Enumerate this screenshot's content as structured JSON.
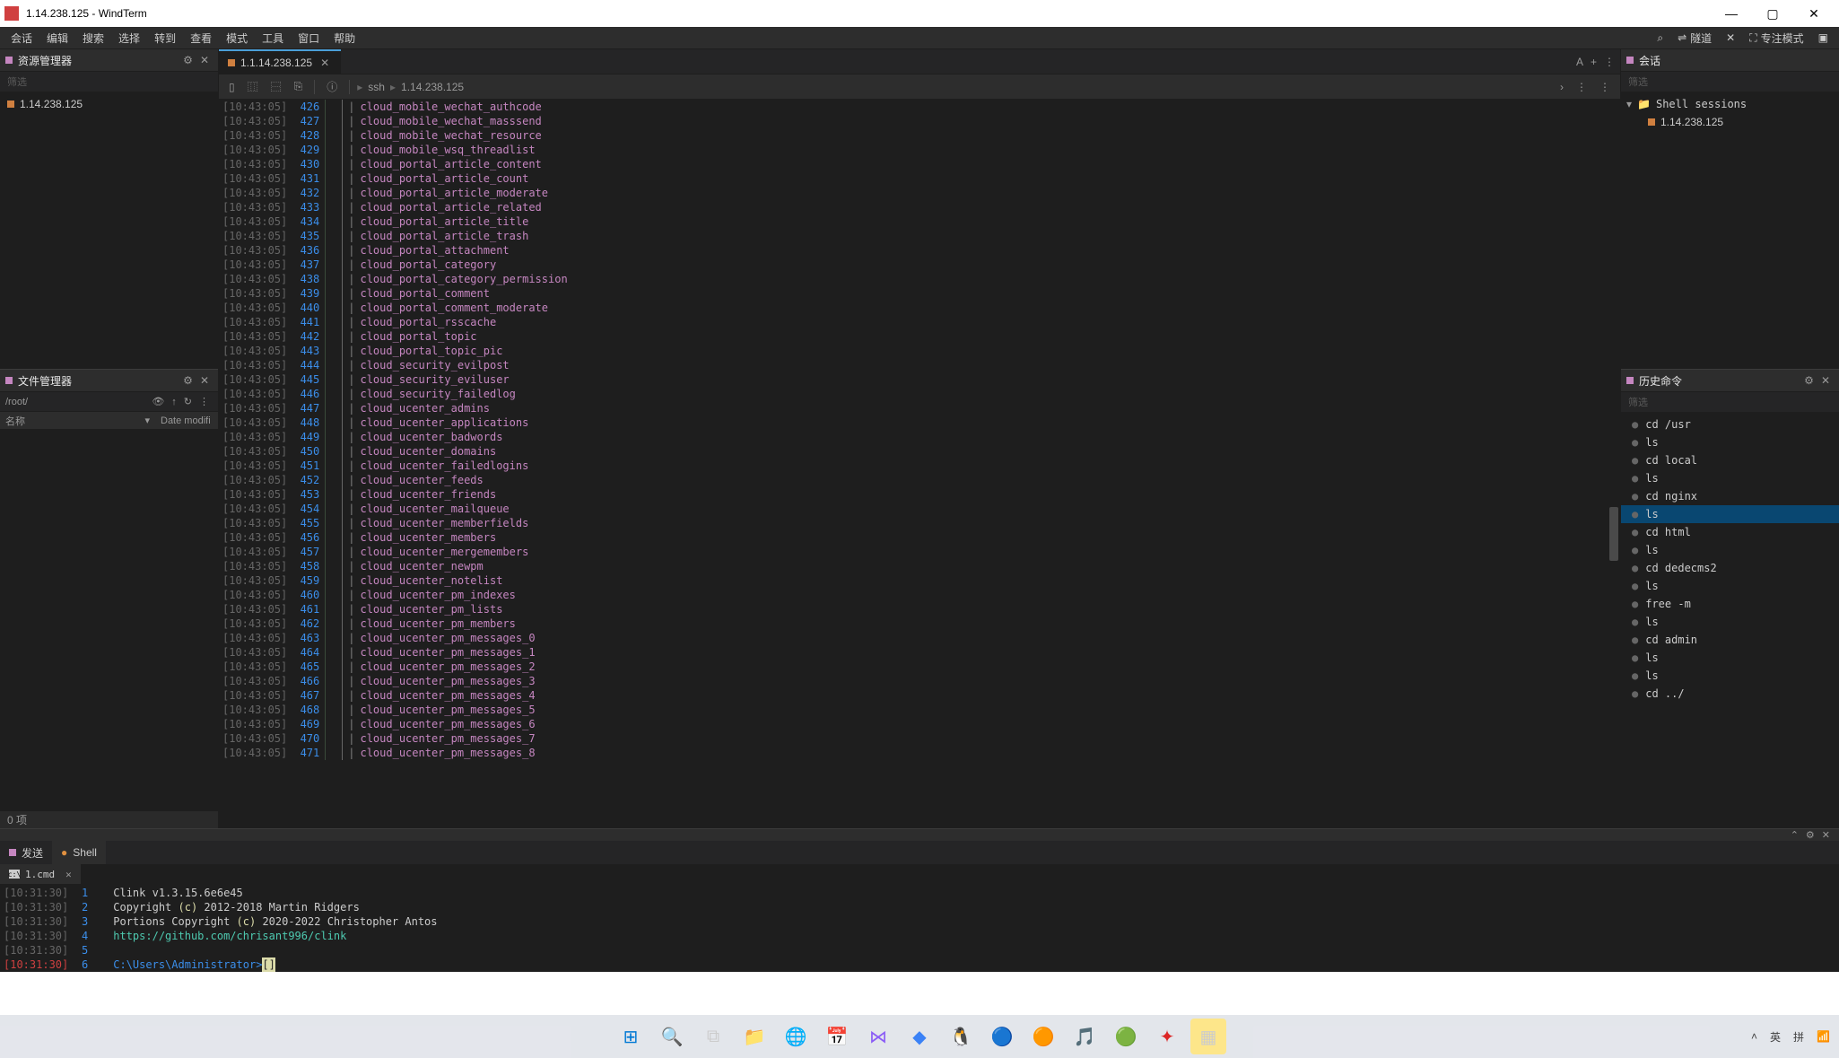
{
  "window": {
    "title": "1.14.238.125 - WindTerm"
  },
  "menu": {
    "items": [
      "会话",
      "编辑",
      "搜索",
      "选择",
      "转到",
      "查看",
      "模式",
      "工具",
      "窗口",
      "帮助"
    ],
    "right": {
      "search": "⌕",
      "tunnel": "隧道",
      "focus_mode": "专注模式"
    }
  },
  "explorer": {
    "title": "资源管理器",
    "filter": "筛选",
    "items": [
      {
        "label": "1.14.238.125"
      }
    ]
  },
  "files": {
    "title": "文件管理器",
    "path": "/root/",
    "col_name": "名称",
    "col_date": "Date modifi",
    "footer": "0 项"
  },
  "tabs": {
    "items": [
      {
        "label": "1.1.14.238.125",
        "active": true
      }
    ],
    "right_icons": [
      "A",
      "+",
      "⋮"
    ]
  },
  "toolbar": {
    "breadcrumb": [
      "ssh",
      "1.14.238.125"
    ]
  },
  "terminal_rows": [
    {
      "ts": "[10:43:05]",
      "ln": "426",
      "txt": "cloud_mobile_wechat_authcode"
    },
    {
      "ts": "[10:43:05]",
      "ln": "427",
      "txt": "cloud_mobile_wechat_masssend"
    },
    {
      "ts": "[10:43:05]",
      "ln": "428",
      "txt": "cloud_mobile_wechat_resource"
    },
    {
      "ts": "[10:43:05]",
      "ln": "429",
      "txt": "cloud_mobile_wsq_threadlist"
    },
    {
      "ts": "[10:43:05]",
      "ln": "430",
      "txt": "cloud_portal_article_content"
    },
    {
      "ts": "[10:43:05]",
      "ln": "431",
      "txt": "cloud_portal_article_count"
    },
    {
      "ts": "[10:43:05]",
      "ln": "432",
      "txt": "cloud_portal_article_moderate"
    },
    {
      "ts": "[10:43:05]",
      "ln": "433",
      "txt": "cloud_portal_article_related"
    },
    {
      "ts": "[10:43:05]",
      "ln": "434",
      "txt": "cloud_portal_article_title"
    },
    {
      "ts": "[10:43:05]",
      "ln": "435",
      "txt": "cloud_portal_article_trash"
    },
    {
      "ts": "[10:43:05]",
      "ln": "436",
      "txt": "cloud_portal_attachment"
    },
    {
      "ts": "[10:43:05]",
      "ln": "437",
      "txt": "cloud_portal_category"
    },
    {
      "ts": "[10:43:05]",
      "ln": "438",
      "txt": "cloud_portal_category_permission"
    },
    {
      "ts": "[10:43:05]",
      "ln": "439",
      "txt": "cloud_portal_comment"
    },
    {
      "ts": "[10:43:05]",
      "ln": "440",
      "txt": "cloud_portal_comment_moderate"
    },
    {
      "ts": "[10:43:05]",
      "ln": "441",
      "txt": "cloud_portal_rsscache"
    },
    {
      "ts": "[10:43:05]",
      "ln": "442",
      "txt": "cloud_portal_topic"
    },
    {
      "ts": "[10:43:05]",
      "ln": "443",
      "txt": "cloud_portal_topic_pic"
    },
    {
      "ts": "[10:43:05]",
      "ln": "444",
      "txt": "cloud_security_evilpost"
    },
    {
      "ts": "[10:43:05]",
      "ln": "445",
      "txt": "cloud_security_eviluser"
    },
    {
      "ts": "[10:43:05]",
      "ln": "446",
      "txt": "cloud_security_failedlog"
    },
    {
      "ts": "[10:43:05]",
      "ln": "447",
      "txt": "cloud_ucenter_admins"
    },
    {
      "ts": "[10:43:05]",
      "ln": "448",
      "txt": "cloud_ucenter_applications"
    },
    {
      "ts": "[10:43:05]",
      "ln": "449",
      "txt": "cloud_ucenter_badwords"
    },
    {
      "ts": "[10:43:05]",
      "ln": "450",
      "txt": "cloud_ucenter_domains"
    },
    {
      "ts": "[10:43:05]",
      "ln": "451",
      "txt": "cloud_ucenter_failedlogins"
    },
    {
      "ts": "[10:43:05]",
      "ln": "452",
      "txt": "cloud_ucenter_feeds"
    },
    {
      "ts": "[10:43:05]",
      "ln": "453",
      "txt": "cloud_ucenter_friends"
    },
    {
      "ts": "[10:43:05]",
      "ln": "454",
      "txt": "cloud_ucenter_mailqueue"
    },
    {
      "ts": "[10:43:05]",
      "ln": "455",
      "txt": "cloud_ucenter_memberfields"
    },
    {
      "ts": "[10:43:05]",
      "ln": "456",
      "txt": "cloud_ucenter_members"
    },
    {
      "ts": "[10:43:05]",
      "ln": "457",
      "txt": "cloud_ucenter_mergemembers"
    },
    {
      "ts": "[10:43:05]",
      "ln": "458",
      "txt": "cloud_ucenter_newpm"
    },
    {
      "ts": "[10:43:05]",
      "ln": "459",
      "txt": "cloud_ucenter_notelist"
    },
    {
      "ts": "[10:43:05]",
      "ln": "460",
      "txt": "cloud_ucenter_pm_indexes"
    },
    {
      "ts": "[10:43:05]",
      "ln": "461",
      "txt": "cloud_ucenter_pm_lists"
    },
    {
      "ts": "[10:43:05]",
      "ln": "462",
      "txt": "cloud_ucenter_pm_members"
    },
    {
      "ts": "[10:43:05]",
      "ln": "463",
      "txt": "cloud_ucenter_pm_messages_0"
    },
    {
      "ts": "[10:43:05]",
      "ln": "464",
      "txt": "cloud_ucenter_pm_messages_1"
    },
    {
      "ts": "[10:43:05]",
      "ln": "465",
      "txt": "cloud_ucenter_pm_messages_2"
    },
    {
      "ts": "[10:43:05]",
      "ln": "466",
      "txt": "cloud_ucenter_pm_messages_3"
    },
    {
      "ts": "[10:43:05]",
      "ln": "467",
      "txt": "cloud_ucenter_pm_messages_4"
    },
    {
      "ts": "[10:43:05]",
      "ln": "468",
      "txt": "cloud_ucenter_pm_messages_5"
    },
    {
      "ts": "[10:43:05]",
      "ln": "469",
      "txt": "cloud_ucenter_pm_messages_6"
    },
    {
      "ts": "[10:43:05]",
      "ln": "470",
      "txt": "cloud_ucenter_pm_messages_7"
    },
    {
      "ts": "[10:43:05]",
      "ln": "471",
      "txt": "cloud_ucenter_pm_messages_8"
    }
  ],
  "sessions": {
    "title": "会话",
    "folder": "Shell sessions",
    "items": [
      {
        "label": "1.14.238.125"
      }
    ]
  },
  "history": {
    "title": "历史命令",
    "filter": "筛选",
    "items": [
      {
        "cmd": "cd /usr"
      },
      {
        "cmd": "ls"
      },
      {
        "cmd": "cd local"
      },
      {
        "cmd": "ls"
      },
      {
        "cmd": "cd nginx"
      },
      {
        "cmd": "ls",
        "selected": true
      },
      {
        "cmd": "cd html"
      },
      {
        "cmd": "ls"
      },
      {
        "cmd": "cd dedecms2"
      },
      {
        "cmd": "ls"
      },
      {
        "cmd": "free -m"
      },
      {
        "cmd": "ls"
      },
      {
        "cmd": "cd admin"
      },
      {
        "cmd": "ls"
      },
      {
        "cmd": "ls"
      },
      {
        "cmd": "cd ../"
      }
    ]
  },
  "bottom": {
    "send_tab": "发送",
    "shell_tab": "Shell",
    "sub_tab": "1.cmd",
    "rows": [
      {
        "ts": "[10:31:30]",
        "ln": "1",
        "plain": "Clink v1.3.15.6e6e45"
      },
      {
        "ts": "[10:31:30]",
        "ln": "2",
        "pre": "Copyright ",
        "paren": "(c)",
        "post": " 2012-2018 Martin Ridgers"
      },
      {
        "ts": "[10:31:30]",
        "ln": "3",
        "pre": "Portions Copyright ",
        "paren": "(c)",
        "post": " 2020-2022 Christopher Antos"
      },
      {
        "ts": "[10:31:30]",
        "ln": "4",
        "link": "https://github.com/chrisant996/clink"
      },
      {
        "ts": "[10:31:30]",
        "ln": "5",
        "plain": ""
      },
      {
        "ts": "[10:31:30]",
        "ln": "6",
        "path": "C:\\Users\\Administrator>",
        "cursor": "[]",
        "last": true
      }
    ]
  },
  "tray": {
    "ime1": "英",
    "ime2": "拼"
  }
}
